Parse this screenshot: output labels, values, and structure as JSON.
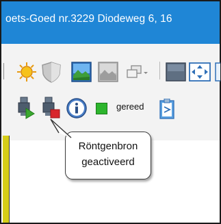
{
  "window": {
    "title": "oets-Goed nr.3229 Diodeweg 6, 16"
  },
  "toolbar_top": {
    "items": [
      {
        "icon": "sun-icon"
      },
      {
        "icon": "shield-icon"
      },
      {
        "icon": "landscape-image-icon"
      },
      {
        "icon": "grayscale-image-icon"
      },
      {
        "icon": "window-layout-dropdown-icon"
      },
      {
        "icon": "dark-square-icon"
      },
      {
        "icon": "fit-to-screen-icon"
      }
    ]
  },
  "toolbar_status": {
    "xray_on_icon": "xray-source-on-icon",
    "xray_off_icon": "xray-source-off-icon",
    "info_icon": "info-icon",
    "status_light_color": "#2db52d",
    "status_text": "gereed",
    "clipboard_icon": "clipboard-icon"
  },
  "tooltip": {
    "line1": "Röntgenbron",
    "line2": "geactiveerd"
  },
  "colors": {
    "titlebar": "#1f86d6",
    "toolbar_bg": "#f3f3f3",
    "accent_strip": "#d6cd18"
  }
}
